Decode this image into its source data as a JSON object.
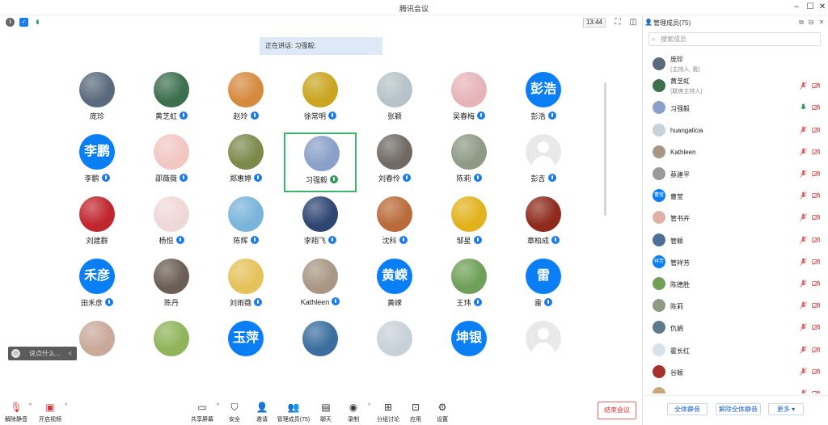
{
  "window": {
    "title": "腾讯会议",
    "time": "13:44"
  },
  "speaking": {
    "label": "正在讲话: 习强毅;"
  },
  "participants": [
    {
      "name": "庞珍",
      "avatar": "photo",
      "color": "#5a6a7d",
      "mic": "none"
    },
    {
      "name": "黄芝虹",
      "avatar": "photo",
      "color": "#3c6f4e",
      "mic": "host"
    },
    {
      "name": "赵玲",
      "avatar": "photo",
      "color": "#d68a3e",
      "mic": "muted"
    },
    {
      "name": "徐常明",
      "avatar": "photo",
      "color": "#c9a520",
      "mic": "muted"
    },
    {
      "name": "张颖",
      "avatar": "photo",
      "color": "#b6c3c9",
      "mic": "none"
    },
    {
      "name": "吴春梅",
      "avatar": "photo",
      "color": "#e6b4b8",
      "mic": "muted"
    },
    {
      "name": "彭浩",
      "avatar": "text",
      "text": "彭浩",
      "mic": "muted"
    },
    {
      "name": "李鹏",
      "avatar": "text",
      "text": "李鹏",
      "mic": "muted"
    },
    {
      "name": "邵薇薇",
      "avatar": "photo",
      "color": "#f2c7c3",
      "mic": "muted"
    },
    {
      "name": "郑惠婷",
      "avatar": "photo",
      "color": "#7d8a4c",
      "mic": "muted"
    },
    {
      "name": "习强毅",
      "avatar": "photo",
      "color": "#8aa0c8",
      "mic": "on",
      "active": true
    },
    {
      "name": "刘春伶",
      "avatar": "photo",
      "color": "#6f6a66",
      "mic": "muted"
    },
    {
      "name": "陈莉",
      "avatar": "photo",
      "color": "#8e9a86",
      "mic": "muted"
    },
    {
      "name": "彭吉",
      "avatar": "ghost",
      "mic": "muted"
    },
    {
      "name": "刘建群",
      "avatar": "photo",
      "color": "#c0262d",
      "mic": "none"
    },
    {
      "name": "杨恒",
      "avatar": "photo",
      "color": "#f0d8d8",
      "mic": "muted"
    },
    {
      "name": "陈辉",
      "avatar": "photo",
      "color": "#7ab4da",
      "mic": "muted"
    },
    {
      "name": "李翔飞",
      "avatar": "photo",
      "color": "#2e4672",
      "mic": "muted"
    },
    {
      "name": "沈科",
      "avatar": "photo",
      "color": "#b96b3a",
      "mic": "muted"
    },
    {
      "name": "邹星",
      "avatar": "photo",
      "color": "#e2b21c",
      "mic": "muted"
    },
    {
      "name": "章柏成",
      "avatar": "photo",
      "color": "#8f2a1d",
      "mic": "muted"
    },
    {
      "name": "田禾彦",
      "avatar": "text",
      "text": "禾彦",
      "mic": "muted"
    },
    {
      "name": "陈丹",
      "avatar": "photo",
      "color": "#6b5e54",
      "mic": "none"
    },
    {
      "name": "刘雨薇",
      "avatar": "photo",
      "color": "#e5c25a",
      "mic": "muted"
    },
    {
      "name": "Kathleen",
      "avatar": "photo",
      "color": "#a89784",
      "mic": "muted"
    },
    {
      "name": "黄嵘",
      "avatar": "text",
      "text": "黄嵘",
      "mic": "none"
    },
    {
      "name": "王玮",
      "avatar": "photo",
      "color": "#6f9f58",
      "mic": "muted"
    },
    {
      "name": "雷",
      "avatar": "text",
      "text": "雷",
      "mic": "muted"
    },
    {
      "name": "",
      "avatar": "photo",
      "color": "#c9a99a",
      "mic": "none"
    },
    {
      "name": "",
      "avatar": "photo",
      "color": "#8fb45a",
      "mic": "none"
    },
    {
      "name": "",
      "avatar": "text",
      "text": "玉萍",
      "mic": "none"
    },
    {
      "name": "",
      "avatar": "photo",
      "color": "#3b6e9f",
      "mic": "none"
    },
    {
      "name": "",
      "avatar": "photo",
      "color": "#c8d0d8",
      "mic": "none"
    },
    {
      "name": "",
      "avatar": "text",
      "text": "坤银",
      "mic": "none"
    },
    {
      "name": "",
      "avatar": "ghost",
      "mic": "none"
    }
  ],
  "chat": {
    "placeholder": "说点什么...",
    "arrow": "<"
  },
  "toolbar": {
    "unmute": "解除静音",
    "start_video": "开启视频",
    "share": "共享屏幕",
    "security": "安全",
    "invite": "邀请",
    "members": "管理成员(75)",
    "chat": "聊天",
    "record": "录制",
    "breakout": "分组讨论",
    "apps": "应用",
    "settings": "设置",
    "end": "结束会议"
  },
  "sidebar": {
    "title": "管理成员(75)",
    "search_placeholder": "搜索成员",
    "members": [
      {
        "name": "庞珍",
        "sub": "(主持人, 我)",
        "color": "#5a6a7d",
        "mic": "none"
      },
      {
        "name": "黄芝虹",
        "sub": "(联席主持人)",
        "color": "#3c6f4e",
        "mic": "muted"
      },
      {
        "name": "习强毅",
        "sub": "",
        "color": "#8aa0c8",
        "mic": "on"
      },
      {
        "name": "huangalicia",
        "sub": "",
        "color": "#c8d0d8",
        "mic": "muted"
      },
      {
        "name": "Kathleen",
        "sub": "",
        "color": "#a89784",
        "mic": "muted"
      },
      {
        "name": "蔡建平",
        "sub": "",
        "color": "#9a9a9a",
        "mic": "muted"
      },
      {
        "name": "曹莹",
        "sub": "",
        "color": "#0a7ff5",
        "text": "曹莹",
        "mic": "muted"
      },
      {
        "name": "管书卉",
        "sub": "",
        "color": "#e0b0a8",
        "mic": "muted"
      },
      {
        "name": "管颖",
        "sub": "",
        "color": "#4e6f96",
        "mic": "muted"
      },
      {
        "name": "管祥芳",
        "sub": "",
        "color": "#0a7ff5",
        "text": "祥芳",
        "mic": "muted"
      },
      {
        "name": "陈德胜",
        "sub": "",
        "color": "#6f9f58",
        "mic": "muted"
      },
      {
        "name": "陈莉",
        "sub": "",
        "color": "#8e9a86",
        "mic": "muted"
      },
      {
        "name": "仇娟",
        "sub": "",
        "color": "#5d7a8c",
        "mic": "muted"
      },
      {
        "name": "霍长红",
        "sub": "",
        "color": "#d8e2ea",
        "mic": "muted"
      },
      {
        "name": "谷颖",
        "sub": "",
        "color": "#a5322a",
        "mic": "muted"
      },
      {
        "name": "",
        "sub": "",
        "color": "#c8a87a",
        "mic": "muted"
      }
    ],
    "mute_all": "全体静音",
    "unmute_all": "解除全体静音",
    "more": "更多 ▾"
  },
  "colors": {
    "accent": "#0a7ff5",
    "active_border": "#3bb36b",
    "end": "#dd3333",
    "muted": "#e06a6a"
  }
}
